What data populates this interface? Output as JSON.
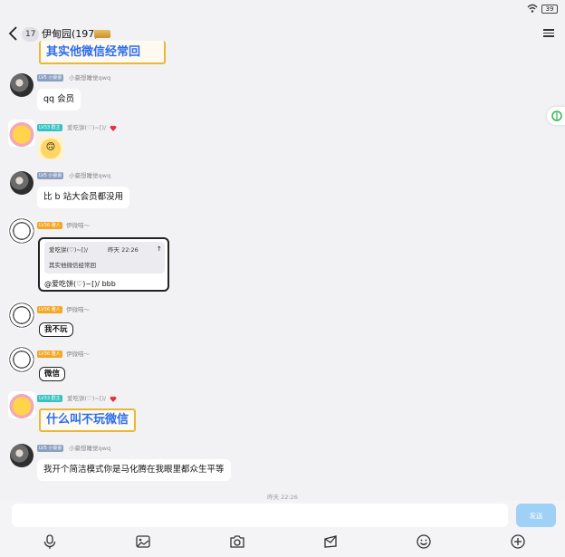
{
  "status_bar": {
    "battery": "39"
  },
  "header": {
    "unread_count": "17",
    "title": "伊甸园(197)"
  },
  "messages": [
    {
      "type": "fancy-partial",
      "text": "其实他微信经常回"
    },
    {
      "sender": "小豪想睡觉qwq",
      "level": "LV5 小豪豪",
      "text": "qq 会员"
    },
    {
      "sender": "爱吃饼(♡)~[)/",
      "level": "LV33 群主",
      "sticker": "🙃"
    },
    {
      "sender": "小豪想睡觉qwq",
      "level": "LV5 小豪豪",
      "text": "比 b 站大会员都没用"
    },
    {
      "sender": "伊微喵～",
      "level": "LV36 雅人",
      "quote": {
        "author": "爱吃饼(♡)~[)/",
        "time": "昨天 22:26",
        "text": "其实他微信经常回"
      },
      "text": "@爱吃饼(♡)~[)/ bbb"
    },
    {
      "sender": "伊微喵～",
      "level": "LV36 雅人",
      "text": "我不玩"
    },
    {
      "sender": "伊微喵～",
      "level": "LV36 雅人",
      "text": "微信"
    },
    {
      "sender": "爱吃饼(♡)~[)/",
      "level": "LV33 群主",
      "text": "什么叫不玩微信"
    },
    {
      "sender": "小豪想睡觉qwq",
      "level": "LV5 小豪豪",
      "text": "我开个简洁模式你是马化腾在我眼里都众生平等"
    }
  ],
  "timestamp": "昨天 22:26",
  "input": {
    "placeholder": "",
    "send_label": "发送"
  },
  "toolbar": [
    "microphone-icon",
    "image-icon",
    "camera-icon",
    "red-packet-icon",
    "emoji-icon",
    "plus-icon"
  ],
  "colors": {
    "accent": "#2a6cf0",
    "send_bg": "#9fd0f6",
    "level_teal": "#36c2c2",
    "level_orange": "#f5a623"
  }
}
